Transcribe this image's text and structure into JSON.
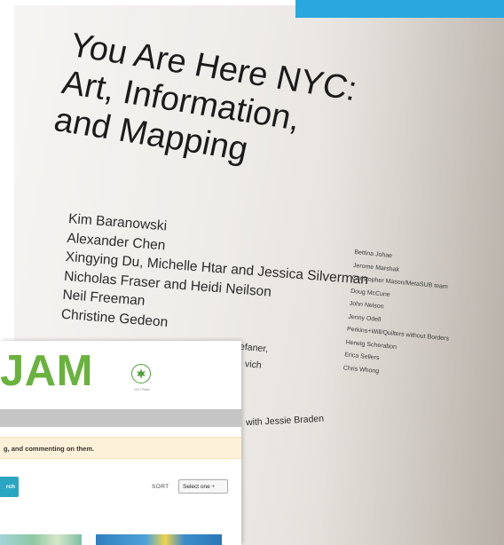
{
  "wall": {
    "title_lines": [
      "You Are Here NYC:",
      "Art, Information,",
      "and Mapping"
    ],
    "artists_left": [
      "Kim Baranowski",
      "Alexander Chen",
      "Xingying Du, Michelle Htar and Jessica Silverman",
      "Nicholas Fraser and Heidi Neilson",
      "Neil Freeman",
      "Christine Gedeon"
    ],
    "fragments": [
      "efaner,",
      "vich",
      "with Jessie Braden"
    ],
    "artists_right": [
      "Bettina Johae",
      "Jerome Marshak",
      "Christopher Mason/MetaSUB team",
      "Doug McCune",
      "John Nelson",
      "Jenny Odell",
      "Perkins+Will/Quilters without Borders",
      "Herwig Scherabon",
      "Erica Sellers",
      "Chris Whong"
    ]
  },
  "inset_site": {
    "logo_text": "JAM",
    "parks_label": "NYC Parks",
    "banner_text": "g, and commenting on them.",
    "search_label": "rch",
    "sort_label": "SORT",
    "sort_selected": "Select one ÷"
  },
  "colors": {
    "accent_tab": "#29a7df",
    "logo_green": "#6ab23e",
    "search_button": "#2aa6c2",
    "banner": "#fdf1d9"
  }
}
